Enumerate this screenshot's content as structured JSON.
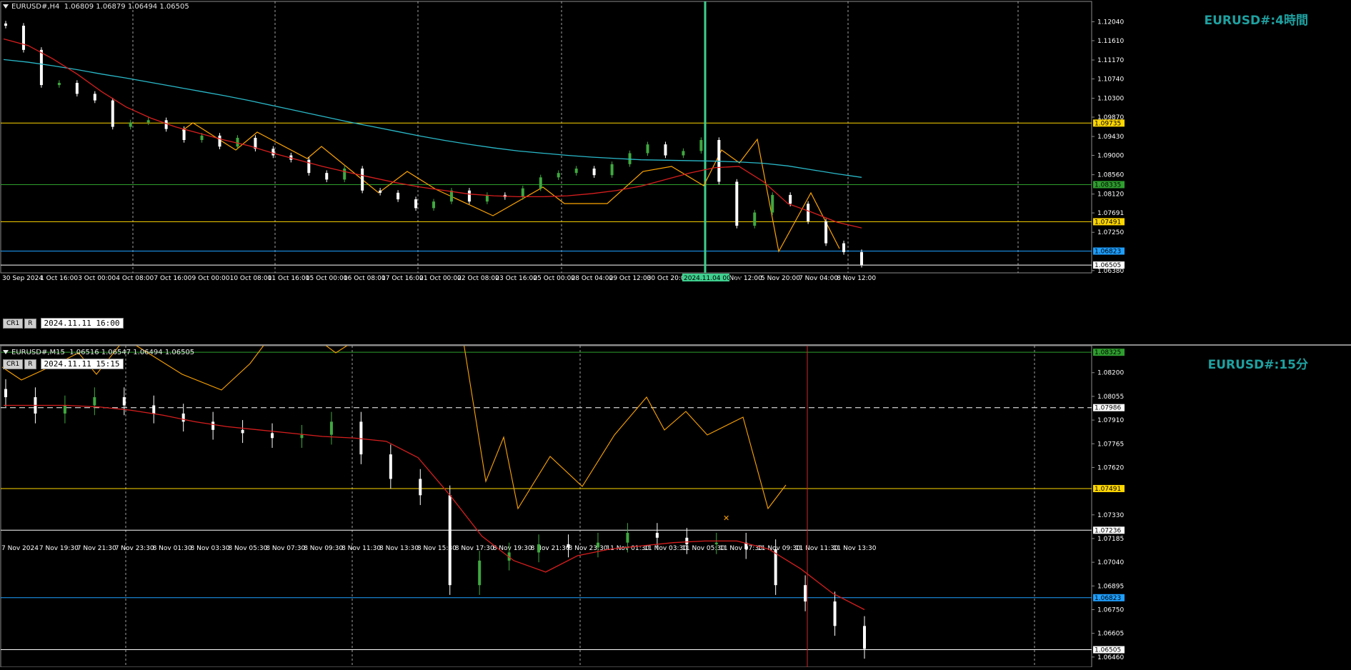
{
  "colors": {
    "background": "#000000",
    "grid": "#c8c8c8",
    "bull": "#3fa93f",
    "bear": "#ffffff",
    "ma_red": "#d81e1e",
    "ma_cyan": "#29b9c9",
    "zigzag": "#ffa500",
    "level_yellow": "#ffd700",
    "level_green": "#2e9e2e",
    "level_blue": "#1e9fff",
    "level_white": "#ffffff",
    "watermark": "#1fa1a1",
    "cursor_green": "#3ecf8e",
    "cursor_red": "#c82828"
  },
  "chart_data": [
    {
      "type": "candlestick",
      "symbol_header": "EURUSD#,H4  1.06809 1.06879 1.06494 1.06505",
      "watermark": "EURUSD#:4時間",
      "buttons": [
        "CR1",
        "R"
      ],
      "cursor_time_box": "2024.11.11 16:00",
      "cursor_time_label": "2024.11.04 00:00",
      "price_range": [
        1.0636,
        1.1221
      ],
      "y_ticks": [
        "1.12040",
        "1.11610",
        "1.11170",
        "1.10740",
        "1.10300",
        "1.09870",
        "1.09430",
        "1.09000",
        "1.08560",
        "1.08120",
        "1.07691",
        "1.07250",
        "1.06380"
      ],
      "x_labels": [
        "30 Sep 2024",
        "1 Oct 16:00",
        "3 Oct 00:00",
        "4 Oct 08:00",
        "7 Oct 16:00",
        "9 Oct 00:00",
        "10 Oct 08:00",
        "11 Oct 16:00",
        "15 Oct 00:00",
        "16 Oct 08:00",
        "17 Oct 16:00",
        "21 Oct 00:00",
        "22 Oct 08:00",
        "23 Oct 16:00",
        "25 Oct 00:00",
        "28 Oct 04:00",
        "29 Oct 12:00",
        "30 Oct 20:00",
        "2024.11.04 00:00",
        "4 Nov 12:00",
        "5 Nov 20:00",
        "7 Nov 04:00",
        "8 Nov 12:00"
      ],
      "levels": [
        {
          "price": 1.09735,
          "label": "1.09735",
          "color": "#ffd700"
        },
        {
          "price": 1.08335,
          "label": "1.08335",
          "color": "#2e9e2e"
        },
        {
          "price": 1.07491,
          "label": "1.07491",
          "color": "#ffd700"
        },
        {
          "price": 1.06823,
          "label": "1.06823",
          "color": "#1e9fff"
        },
        {
          "price": 1.06505,
          "label": "1.06505",
          "color": "#ffffff"
        }
      ],
      "ma_slow": [
        1.1118,
        1.1112,
        1.1104,
        1.1095,
        1.1085,
        1.1076,
        1.1066,
        1.1056,
        1.1046,
        1.1036,
        1.1025,
        1.1013,
        1.1001,
        1.0989,
        1.0977,
        1.0966,
        1.0955,
        1.0944,
        1.0934,
        1.0925,
        1.0917,
        1.091,
        1.0905,
        1.09,
        1.0896,
        1.0893,
        1.089,
        1.0889,
        1.0888,
        1.0887,
        1.0885,
        1.0882,
        1.0876,
        1.0867,
        1.0858,
        1.085
      ],
      "ma_fast": [
        1.1165,
        1.115,
        1.112,
        1.1085,
        1.1045,
        1.101,
        1.0985,
        1.0965,
        1.095,
        1.0935,
        1.0922,
        1.0905,
        1.089,
        1.0875,
        1.0862,
        1.085,
        1.0838,
        1.0828,
        1.082,
        1.0812,
        1.0808,
        1.0806,
        1.0806,
        1.0808,
        1.0813,
        1.082,
        1.083,
        1.0845,
        1.086,
        1.0872,
        1.0875,
        1.084,
        1.079,
        1.077,
        1.0748,
        1.0735
      ],
      "close": [
        1.1195,
        1.114,
        1.106,
        1.1065,
        1.104,
        1.1025,
        1.0965,
        1.0975,
        1.098,
        1.096,
        1.0935,
        1.0945,
        1.092,
        1.094,
        1.0915,
        1.09,
        1.089,
        1.086,
        1.0845,
        1.087,
        1.082,
        1.0815,
        1.08,
        1.078,
        1.0795,
        1.082,
        1.0795,
        1.081,
        1.0805,
        1.0825,
        1.085,
        1.086,
        1.087,
        1.0855,
        1.088,
        1.0905,
        1.0925,
        1.09,
        1.091,
        1.0935,
        1.084,
        1.074,
        1.077,
        1.081,
        1.079,
        1.075,
        1.07,
        1.068,
        1.0651
      ]
    },
    {
      "type": "candlestick",
      "symbol_header": "EURUSD#,M15  1.06516 1.06547 1.06494 1.06505",
      "watermark": "EURUSD#:15分",
      "buttons": [
        "CR1",
        "R"
      ],
      "cursor_time_box": "2024.11.11 15:15",
      "price_range": [
        1.0642,
        1.0833
      ],
      "y_ticks": [
        "1.08200",
        "1.08055",
        "1.07910",
        "1.07765",
        "1.07620",
        "1.07330",
        "1.07185",
        "1.07040",
        "1.06895",
        "1.06750",
        "1.06605",
        "1.06460"
      ],
      "x_labels": [
        "7 Nov 2024",
        "7 Nov 19:30",
        "7 Nov 21:30",
        "7 Nov 23:30",
        "8 Nov 01:30",
        "8 Nov 03:30",
        "8 Nov 05:30",
        "8 Nov 07:30",
        "8 Nov 09:30",
        "8 Nov 11:30",
        "8 Nov 13:30",
        "8 Nov 15:30",
        "8 Nov 17:30",
        "8 Nov 19:30",
        "8 Nov 21:30",
        "8 Nov 23:30",
        "11 Nov 01:30",
        "11 Nov 03:30",
        "11 Nov 05:30",
        "11 Nov 07:30",
        "11 Nov 09:30",
        "11 Nov 11:30",
        "11 Nov 13:30"
      ],
      "levels": [
        {
          "price": 1.08325,
          "label": "1.08325",
          "color": "#2e9e2e"
        },
        {
          "price": 1.07986,
          "label": "1.07986",
          "color": "#ffffff",
          "dashed": true
        },
        {
          "price": 1.07491,
          "label": "1.07491",
          "color": "#ffd700"
        },
        {
          "price": 1.07236,
          "label": "1.07236",
          "color": "#ffffff"
        },
        {
          "price": 1.06823,
          "label": "1.06823",
          "color": "#1e9fff"
        },
        {
          "price": 1.06505,
          "label": "1.06505",
          "color": "#ffffff"
        }
      ],
      "ma_fast": [
        1.08,
        1.08,
        1.08,
        1.0799,
        1.0797,
        1.0794,
        1.079,
        1.0787,
        1.0785,
        1.0783,
        1.0781,
        1.078,
        1.0778,
        1.0768,
        1.0745,
        1.072,
        1.0705,
        1.0698,
        1.0708,
        1.0712,
        1.0714,
        1.0716,
        1.0717,
        1.0717,
        1.0712,
        1.07,
        1.0685,
        1.0675
      ],
      "close": [
        1.0805,
        1.0795,
        1.08,
        1.0805,
        1.08,
        1.0795,
        1.079,
        1.0785,
        1.0783,
        1.078,
        1.0782,
        1.079,
        1.077,
        1.0755,
        1.0745,
        1.069,
        1.0705,
        1.071,
        1.0715,
        1.0713,
        1.0716,
        1.0722,
        1.0719,
        1.0715,
        1.0716,
        1.0712,
        1.069,
        1.068,
        1.0665,
        1.0651
      ]
    }
  ]
}
